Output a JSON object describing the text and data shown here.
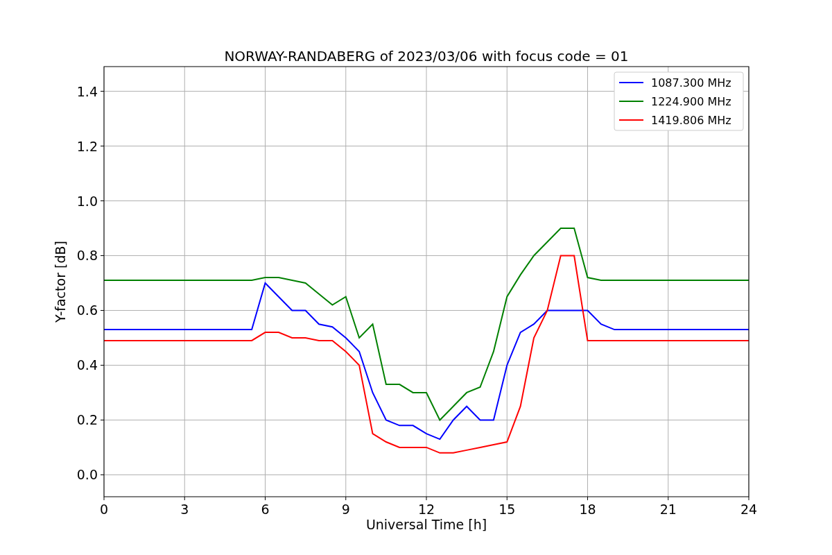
{
  "chart_data": {
    "type": "line",
    "title": "NORWAY-RANDABERG of 2023/03/06 with focus code = 01",
    "xlabel": "Universal Time [h]",
    "ylabel": "Y-factor [dB]",
    "x": [
      0,
      0.5,
      1,
      1.5,
      2,
      2.5,
      3,
      3.5,
      4,
      4.5,
      5,
      5.5,
      6,
      6.5,
      7,
      7.5,
      8,
      8.5,
      9,
      9.5,
      10,
      10.5,
      11,
      11.5,
      12,
      12.5,
      13,
      13.5,
      14,
      14.5,
      15,
      15.5,
      16,
      16.5,
      17,
      17.5,
      18,
      18.5,
      19,
      19.5,
      20,
      20.5,
      21,
      21.5,
      22,
      22.5,
      23,
      23.5,
      24
    ],
    "series": [
      {
        "name": "1087.300 MHz",
        "color": "#0000ff",
        "values": [
          0.53,
          0.53,
          0.53,
          0.53,
          0.53,
          0.53,
          0.53,
          0.53,
          0.53,
          0.53,
          0.53,
          0.53,
          0.7,
          0.65,
          0.6,
          0.6,
          0.55,
          0.54,
          0.5,
          0.45,
          0.3,
          0.2,
          0.18,
          0.18,
          0.15,
          0.13,
          0.2,
          0.25,
          0.2,
          0.2,
          0.4,
          0.52,
          0.55,
          0.6,
          0.6,
          0.6,
          0.6,
          0.55,
          0.53,
          0.53,
          0.53,
          0.53,
          0.53,
          0.53,
          0.53,
          0.53,
          0.53,
          0.53,
          0.53
        ]
      },
      {
        "name": "1224.900 MHz",
        "color": "#008000",
        "values": [
          0.71,
          0.71,
          0.71,
          0.71,
          0.71,
          0.71,
          0.71,
          0.71,
          0.71,
          0.71,
          0.71,
          0.71,
          0.72,
          0.72,
          0.71,
          0.7,
          0.66,
          0.62,
          0.65,
          0.5,
          0.55,
          0.33,
          0.33,
          0.3,
          0.3,
          0.2,
          0.25,
          0.3,
          0.32,
          0.45,
          0.65,
          0.73,
          0.8,
          0.85,
          0.9,
          0.9,
          0.72,
          0.71,
          0.71,
          0.71,
          0.71,
          0.71,
          0.71,
          0.71,
          0.71,
          0.71,
          0.71,
          0.71,
          0.71
        ]
      },
      {
        "name": "1419.806 MHz",
        "color": "#ff0000",
        "values": [
          0.49,
          0.49,
          0.49,
          0.49,
          0.49,
          0.49,
          0.49,
          0.49,
          0.49,
          0.49,
          0.49,
          0.49,
          0.52,
          0.52,
          0.5,
          0.5,
          0.49,
          0.49,
          0.45,
          0.4,
          0.15,
          0.12,
          0.1,
          0.1,
          0.1,
          0.08,
          0.08,
          0.09,
          0.1,
          0.11,
          0.12,
          0.25,
          0.5,
          0.6,
          0.8,
          0.8,
          0.49,
          0.49,
          0.49,
          0.49,
          0.49,
          0.49,
          0.49,
          0.49,
          0.49,
          0.49,
          0.49,
          0.49,
          0.49
        ]
      }
    ],
    "grid": true,
    "legend": true,
    "xlim": [
      0,
      24
    ],
    "ylim": [
      -0.08,
      1.49
    ],
    "xticks": [
      0,
      3,
      6,
      9,
      12,
      15,
      18,
      21,
      24
    ],
    "yticks": [
      {
        "value": 0,
        "label": "0.0"
      },
      {
        "value": 0.2,
        "label": "0.2"
      },
      {
        "value": 0.4,
        "label": "0.4"
      },
      {
        "value": 0.6,
        "label": "0.6"
      },
      {
        "value": 0.8,
        "label": "0.8"
      },
      {
        "value": 1,
        "label": "1.0"
      },
      {
        "value": 1.2,
        "label": "1.2"
      },
      {
        "value": 1.4,
        "label": "1.4"
      }
    ]
  }
}
